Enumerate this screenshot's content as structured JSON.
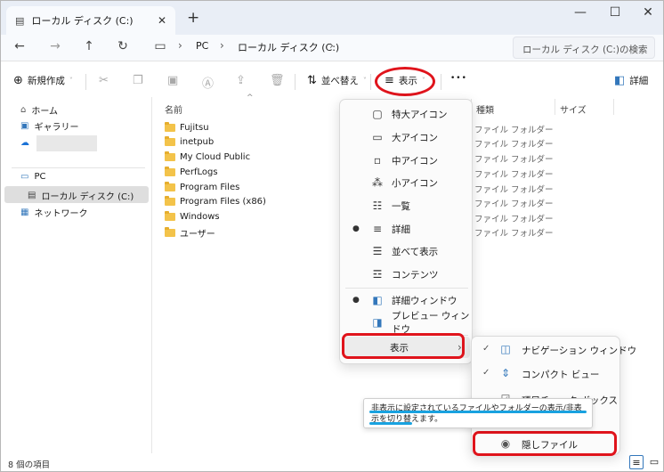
{
  "tab": {
    "title": "ローカル ディスク (C:)",
    "close": "✕",
    "newtab": "+"
  },
  "window_controls": {
    "minimize": "—",
    "maximize": "☐",
    "close": "✕"
  },
  "address": {
    "pc": "PC",
    "current": "ローカル ディスク (C:)",
    "sep": "›"
  },
  "search": {
    "placeholder": "ローカル ディスク (C:)の検索"
  },
  "command_bar": {
    "new_label": "新規作成",
    "sort_label": "並べ替え",
    "view_label": "表示",
    "more": "•••",
    "details_label": "詳細"
  },
  "nav": {
    "items": [
      {
        "label": "ホーム"
      },
      {
        "label": "ギャラリー"
      },
      {
        "label": "PC"
      },
      {
        "label": "ローカル ディスク (C:)"
      },
      {
        "label": "ネットワーク"
      }
    ]
  },
  "columns": {
    "name": "名前",
    "type": "種類",
    "size": "サイズ"
  },
  "files": [
    {
      "name": "Fujitsu",
      "type": "ファイル フォルダー"
    },
    {
      "name": "inetpub",
      "type": "ファイル フォルダー"
    },
    {
      "name": "My Cloud Public",
      "type": "ファイル フォルダー"
    },
    {
      "name": "PerfLogs",
      "type": "ファイル フォルダー"
    },
    {
      "name": "Program Files",
      "type": "ファイル フォルダー"
    },
    {
      "name": "Program Files (x86)",
      "type": "ファイル フォルダー"
    },
    {
      "name": "Windows",
      "type": "ファイル フォルダー"
    },
    {
      "name": "ユーザー",
      "type": "ファイル フォルダー"
    }
  ],
  "view_menu": {
    "items": [
      {
        "label": "特大アイコン"
      },
      {
        "label": "大アイコン"
      },
      {
        "label": "中アイコン"
      },
      {
        "label": "小アイコン"
      },
      {
        "label": "一覧"
      },
      {
        "label": "詳細"
      },
      {
        "label": "並べて表示"
      },
      {
        "label": "コンテンツ"
      },
      {
        "label": "詳細ウィンドウ"
      },
      {
        "label": "プレビュー ウィンドウ"
      },
      {
        "label": "表示"
      }
    ],
    "bullet": "●",
    "arrow": "›"
  },
  "show_submenu": {
    "items": [
      {
        "label": "ナビゲーション ウィンドウ"
      },
      {
        "label": "コンパクト ビュー"
      },
      {
        "label": "項目チェック ボックス"
      },
      {
        "label": "隠しファイル"
      }
    ],
    "check": "✓"
  },
  "tooltip": {
    "text": "非表示に設定されているファイルやフォルダーの表示/非表示を切り替えます。"
  },
  "status": {
    "count": "8 個の項目"
  }
}
